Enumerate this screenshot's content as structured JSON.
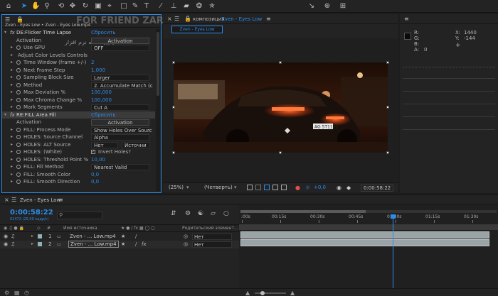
{
  "toolbar": {
    "tools": [
      "home-icon",
      "selection-tool",
      "hand-tool",
      "zoom-tool",
      "orbit-tool",
      "pan-behind-tool",
      "rotate-tool",
      "camera-tool",
      "mask-tool",
      "rectangle-tool",
      "pen-tool",
      "type-tool",
      "brush-tool",
      "clone-stamp-tool",
      "eraser-tool",
      "roto-brush-tool",
      "puppet-pin-tool"
    ]
  },
  "effect_controls": {
    "tab_label": "Zven - Eyes Low • Zven - Eyes Low.mp4",
    "watermark": "FOR FRIEND ZAR.COM",
    "watermark_sub": "اولین نسخه نرم افزار",
    "rows": [
      {
        "label": "DE:Flicker Time Lapse",
        "reset": "Сбросить",
        "kind": "effect"
      },
      {
        "label": "Activation",
        "button": "Activation",
        "kind": "button"
      },
      {
        "label": "Use GPU",
        "dropdown": "OFF",
        "kind": "dropdown"
      },
      {
        "label": "Adjust Color Levels Controls",
        "kind": "group"
      },
      {
        "label": "Time Window (frame +/-)",
        "value": "2",
        "kind": "value"
      },
      {
        "label": "Next Frame Step",
        "value": "1,000",
        "kind": "value"
      },
      {
        "label": "Sampling Block Size",
        "dropdown": "Larger",
        "kind": "dropdown"
      },
      {
        "label": "Method",
        "dropdown": "2. Accumulate Match (c",
        "kind": "dropdown"
      },
      {
        "label": "Max Deviation %",
        "value": "100,000",
        "kind": "value"
      },
      {
        "label": "Max Chroma Change %",
        "value": "100,000",
        "kind": "value"
      },
      {
        "label": "Mark Segments",
        "dropdown": "Cut A",
        "kind": "dropdown"
      },
      {
        "label": "RE:FILL Area Fill",
        "reset": "Сбросить",
        "kind": "effect-selected"
      },
      {
        "label": "Activation",
        "button": "Activation",
        "kind": "button"
      },
      {
        "label": "FILL: Process Mode",
        "dropdown": "Show Holes Over Sourc",
        "kind": "dropdown"
      },
      {
        "label": "HOLES: Source Channel",
        "dropdown": "Alpha",
        "kind": "dropdown"
      },
      {
        "label": "HOLES: ALT Source",
        "dropdown": "Нет",
        "dropdown2": "Источни",
        "kind": "dropdown2"
      },
      {
        "label": "HOLES: (White)",
        "checkbox": "Invert Holes?",
        "kind": "checkbox"
      },
      {
        "label": "HOLES: Threshold Point %",
        "value": "10,00",
        "kind": "value"
      },
      {
        "label": "FILL: Fill Method",
        "dropdown": "Nearest Valid",
        "kind": "dropdown"
      },
      {
        "label": "FILL: Smooth Color",
        "value": "0,0",
        "kind": "value"
      },
      {
        "label": "FILL: Smooth Direction",
        "value": "0,0",
        "kind": "value"
      }
    ]
  },
  "composition": {
    "tab_prefix": "композиция",
    "tab_name": "Zven - Eyes Low",
    "sub_tab": "Zven - Eyes Low",
    "plate_text": "AG 5T1101",
    "footer": {
      "zoom": "(25%)",
      "resolution": "(Четверть)",
      "exposure": "+0,0",
      "timecode": "0:00:58:22"
    }
  },
  "info": {
    "labels": [
      "R:",
      "G:",
      "B:",
      "A:"
    ],
    "a_value": "0",
    "x_label": "X:",
    "x_value": "1440",
    "y_label": "Y:",
    "y_value": "-144"
  },
  "timeline": {
    "tab_name": "Zven - Eyes Low",
    "timecode": "0:00:58:22",
    "frame_info": "01472 (25,00 кадр/с)",
    "search_placeholder": "",
    "col_source": "Имя источника",
    "col_parent": "Родительский элемент...",
    "ruler_ticks": [
      ":00s",
      "00:15s",
      "00:30s",
      "00:45s",
      "01:00s",
      "01:15s",
      "01:30s"
    ],
    "playhead_seconds": 58.88,
    "layers": [
      {
        "index": "1",
        "name": "Zven - ... Low.mp4",
        "parent": "Нет"
      },
      {
        "index": "2",
        "name": "Zven - ... Low.mp4",
        "parent": "Нет"
      }
    ]
  },
  "colors": {
    "accent": "#2d8ceb",
    "panel": "#232323",
    "track": "#9aa3a6"
  }
}
